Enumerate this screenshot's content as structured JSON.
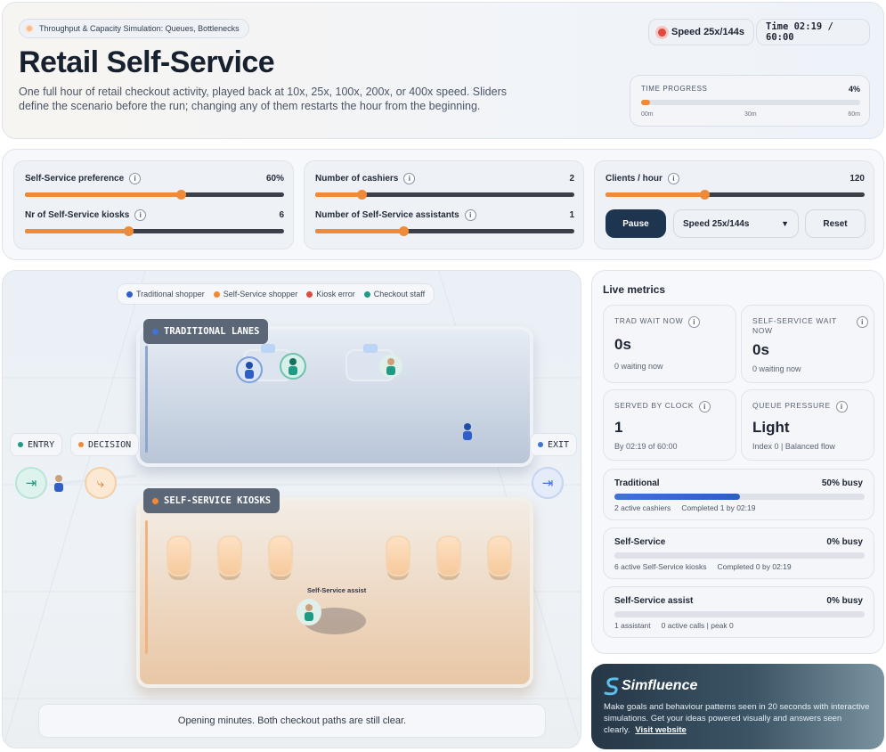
{
  "header": {
    "badge": "Throughput & Capacity Simulation: Queues, Bottlenecks",
    "title": "Retail Self-Service",
    "description": "One full hour of retail checkout activity, played back at 10x, 25x, 100x, 200x, or 400x speed. Sliders define the scenario before the run; changing any of them restarts the hour from the beginning.",
    "speed_chip": "Speed 25x/144s",
    "time_chip": "Time 02:19 / 60:00",
    "progress": {
      "label": "TIME PROGRESS",
      "value_text": "4%",
      "fraction": 0.04,
      "ticks": [
        "00m",
        "30m",
        "60m"
      ]
    }
  },
  "controls": {
    "self_service_pref": {
      "label": "Self-Service preference",
      "value": "60%",
      "fraction": 0.6
    },
    "kiosks": {
      "label": "Nr of Self-Service kiosks",
      "value": "6",
      "fraction": 0.4
    },
    "cashiers": {
      "label": "Number of cashiers",
      "value": "2",
      "fraction": 0.18
    },
    "assistants": {
      "label": "Number of Self-Service assistants",
      "value": "1",
      "fraction": 0.34
    },
    "clients": {
      "label": "Clients / hour",
      "value": "120",
      "fraction": 0.38
    },
    "pause_label": "Pause",
    "speed_select": "Speed 25x/144s",
    "reset_label": "Reset"
  },
  "sim": {
    "legend": [
      "Traditional shopper",
      "Self-Service shopper",
      "Kiosk error",
      "Checkout staff"
    ],
    "legend_colors": [
      "#2f5fc9",
      "#f08a36",
      "#e04b3f",
      "#1f9a84"
    ],
    "traditional_lanes": "TRADITIONAL LANES",
    "self_service_kiosks": "SELF-SERVICE KIOSKS",
    "entry": "ENTRY",
    "decision": "DECISION",
    "exit": "EXIT",
    "assist_label": "Self-Service assist",
    "status": "Opening minutes. Both checkout paths are still clear."
  },
  "metrics": {
    "title": "Live metrics",
    "trad_wait": {
      "label": "TRAD WAIT NOW",
      "value": "0s",
      "sub": "0 waiting now"
    },
    "ss_wait": {
      "label": "SELF-SERVICE WAIT NOW",
      "value": "0s",
      "sub": "0 waiting now"
    },
    "served": {
      "label": "SERVED BY CLOCK",
      "value": "1",
      "sub": "By 02:19 of 60:00"
    },
    "pressure": {
      "label": "QUEUE PRESSURE",
      "value": "Light",
      "sub": "Index 0 | Balanced flow"
    },
    "util": [
      {
        "name": "Traditional",
        "value": "50% busy",
        "fraction": 0.5,
        "sub1": "2 active cashiers",
        "sub2": "Completed 1 by 02:19"
      },
      {
        "name": "Self-Service",
        "value": "0% busy",
        "fraction": 0.0,
        "sub1": "6 active Self-Service kiosks",
        "sub2": "Completed 0 by 02:19"
      },
      {
        "name": "Self-Service assist",
        "value": "0% busy",
        "fraction": 0.0,
        "sub1": "1 assistant",
        "sub2": "0 active calls | peak 0"
      }
    ]
  },
  "brand": {
    "name": "Simfluence",
    "text": "Make goals and behaviour patterns seen in 20 seconds with interactive simulations. Get your ideas powered visually and answers seen clearly.",
    "link": "Visit website"
  }
}
